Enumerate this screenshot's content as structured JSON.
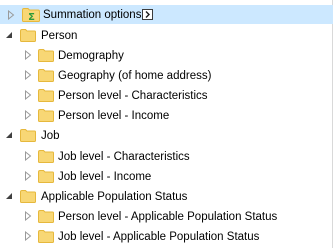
{
  "tree": {
    "items": [
      {
        "label": "Summation options",
        "selected": true,
        "expanded": false,
        "level": 0
      },
      {
        "label": "Person",
        "expanded": true,
        "level": 0
      },
      {
        "label": "Demography",
        "expanded": false,
        "level": 1
      },
      {
        "label": "Geography (of home address)",
        "expanded": false,
        "level": 1
      },
      {
        "label": "Person level - Characteristics",
        "expanded": false,
        "level": 1
      },
      {
        "label": "Person level - Income",
        "expanded": false,
        "level": 1
      },
      {
        "label": "Job",
        "expanded": true,
        "level": 0
      },
      {
        "label": "Job level - Characteristics",
        "expanded": false,
        "level": 1
      },
      {
        "label": "Job level - Income",
        "expanded": false,
        "level": 1
      },
      {
        "label": "Applicable Population Status",
        "expanded": true,
        "level": 0
      },
      {
        "label": "Person level - Applicable Population Status",
        "expanded": false,
        "level": 1
      },
      {
        "label": "Job level - Applicable Population Status",
        "expanded": false,
        "level": 1
      }
    ]
  },
  "colors": {
    "selection": "#cce8ff",
    "folder": "#f8d775",
    "folder_dark": "#e6b83c",
    "sigma_green": "#2e9b3a",
    "arrow_gray": "#9a9a9a",
    "arrow_dark": "#404040"
  }
}
